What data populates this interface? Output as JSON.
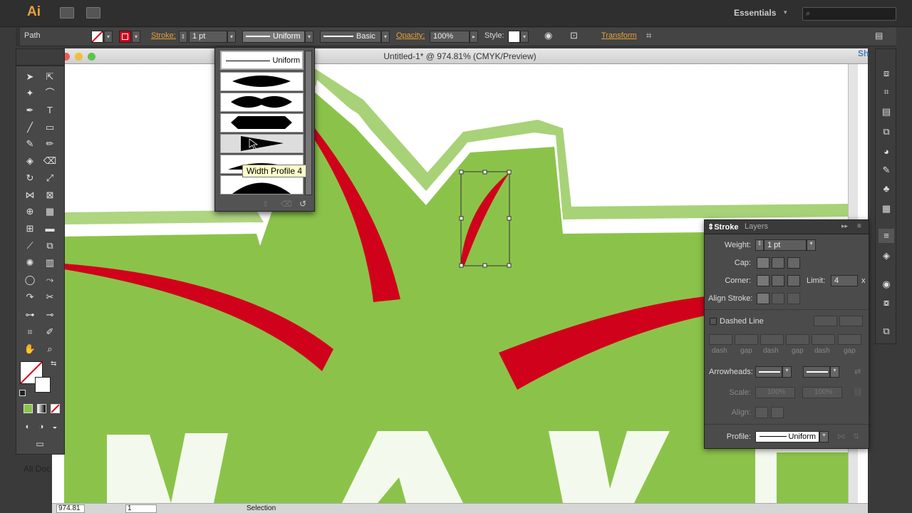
{
  "app": {
    "logo": "Ai",
    "workspace": "Essentials",
    "search_placeholder": ""
  },
  "control_bar": {
    "selection_type": "Path",
    "stroke_label": "Stroke:",
    "stroke_weight": "1 pt",
    "profile_value": "Uniform",
    "brush_value": "Basic",
    "opacity_label": "Opacity:",
    "opacity_value": "100%",
    "style_label": "Style:",
    "transform_label": "Transform"
  },
  "document": {
    "title": "Untitled-1* @ 974.81% (CMYK/Preview)"
  },
  "profile_menu": {
    "first_item": "Uniform",
    "tooltip": "Width Profile 4"
  },
  "stroke_panel": {
    "tabs": [
      "Stroke",
      "Layers"
    ],
    "weight_label": "Weight:",
    "weight_value": "1 pt",
    "cap_label": "Cap:",
    "corner_label": "Corner:",
    "limit_label": "Limit:",
    "limit_value": "4",
    "limit_unit": "x",
    "align_label": "Align Stroke:",
    "dashed_label": "Dashed Line",
    "dash_labels": [
      "dash",
      "gap",
      "dash",
      "gap",
      "dash",
      "gap"
    ],
    "arrowheads_label": "Arrowheads:",
    "scale_label": "Scale:",
    "scale_values": [
      "100%",
      "100%"
    ],
    "align_arrow_label": "Align:",
    "profile_label": "Profile:",
    "profile_value": "Uniform"
  },
  "status_bar": {
    "zoom": "974.81",
    "artboard": "1",
    "tool": "Selection"
  },
  "background_text": {
    "side_tab": "Sh",
    "doc_label": "All Doc"
  },
  "colors": {
    "green": "#8bc34a",
    "red": "#d0021b",
    "accent": "#e6a23c"
  }
}
